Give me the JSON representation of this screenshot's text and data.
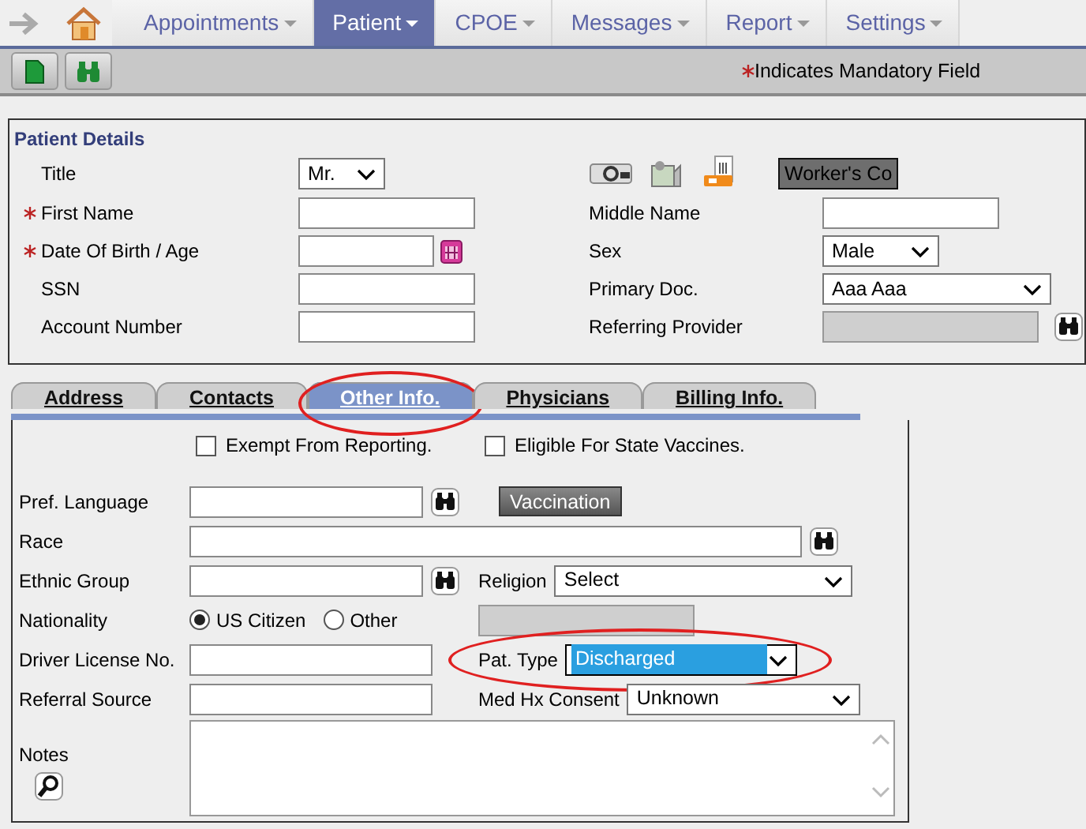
{
  "nav": {
    "items": [
      {
        "label": "Appointments",
        "selected": false
      },
      {
        "label": "Patient",
        "selected": true
      },
      {
        "label": "CPOE",
        "selected": false
      },
      {
        "label": "Messages",
        "selected": false
      },
      {
        "label": "Report",
        "selected": false
      },
      {
        "label": "Settings",
        "selected": false
      }
    ]
  },
  "toolbar": {
    "mandatory_note": "Indicates Mandatory Field"
  },
  "patient_details": {
    "title": "Patient Details",
    "rows": [
      {
        "label": "Title",
        "required": false,
        "field": {
          "kind": "select",
          "value": "Mr."
        },
        "right": {
          "kind": "actions",
          "button": "Worker's Co"
        }
      },
      {
        "label": "First Name",
        "required": true,
        "field": {
          "kind": "text"
        },
        "right": {
          "kind": "field",
          "label": "Middle Name",
          "field": {
            "kind": "text"
          }
        }
      },
      {
        "label": "Date Of Birth / Age",
        "required": true,
        "field": {
          "kind": "date"
        },
        "right": {
          "kind": "field",
          "label": "Sex",
          "field": {
            "kind": "select",
            "value": "Male"
          }
        }
      },
      {
        "label": "SSN",
        "required": false,
        "field": {
          "kind": "text"
        },
        "right": {
          "kind": "field",
          "label": "Primary Doc.",
          "field": {
            "kind": "select",
            "value": "Aaa Aaa"
          }
        }
      },
      {
        "label": "Account Number",
        "required": false,
        "field": {
          "kind": "text"
        },
        "right": {
          "kind": "field",
          "label": "Referring Provider",
          "field": {
            "kind": "lookup_readonly"
          }
        }
      }
    ]
  },
  "tabs": [
    {
      "label": "Address",
      "selected": false,
      "highlighted": false
    },
    {
      "label": "Contacts",
      "selected": false,
      "highlighted": false
    },
    {
      "label": "Other Info.",
      "selected": true,
      "highlighted": true
    },
    {
      "label": "Physicians",
      "selected": false,
      "highlighted": false
    },
    {
      "label": "Billing Info.",
      "selected": false,
      "highlighted": false
    }
  ],
  "other_info": {
    "checkboxes": [
      {
        "label": "Exempt From Reporting.",
        "checked": false
      },
      {
        "label": "Eligible For State Vaccines.",
        "checked": false
      }
    ],
    "rows": [
      {
        "kind": "field",
        "label": "Pref. Language",
        "items": [
          {
            "kind": "text"
          },
          {
            "kind": "lookup"
          },
          {
            "kind": "button",
            "label": "Vaccination"
          }
        ]
      },
      {
        "kind": "field",
        "label": "Race",
        "items": [
          {
            "kind": "text"
          },
          {
            "kind": "lookup"
          }
        ]
      },
      {
        "kind": "field",
        "label": "Ethnic Group",
        "items": [
          {
            "kind": "text"
          },
          {
            "kind": "lookup"
          },
          {
            "kind": "label",
            "text": "Religion"
          },
          {
            "kind": "select",
            "value": "Select"
          }
        ]
      },
      {
        "kind": "field",
        "label": "Nationality",
        "items": [
          {
            "kind": "radio",
            "label": "US Citizen",
            "selected": true
          },
          {
            "kind": "radio",
            "label": "Other",
            "selected": false
          },
          {
            "kind": "disabled"
          }
        ]
      },
      {
        "kind": "field",
        "label": "Driver License No.",
        "items": [
          {
            "kind": "text"
          },
          {
            "kind": "label",
            "text": "Pat. Type"
          },
          {
            "kind": "select",
            "value": "Discharged",
            "focused": true,
            "highlighted": true
          }
        ]
      },
      {
        "kind": "field",
        "label": "Referral Source",
        "items": [
          {
            "kind": "text"
          },
          {
            "kind": "label",
            "text": "Med Hx Consent"
          },
          {
            "kind": "select",
            "value": "Unknown",
            "focused": false,
            "highlighted": false
          }
        ]
      },
      {
        "kind": "notes",
        "label": "Notes",
        "items": [
          {
            "kind": "textarea"
          }
        ]
      }
    ]
  }
}
